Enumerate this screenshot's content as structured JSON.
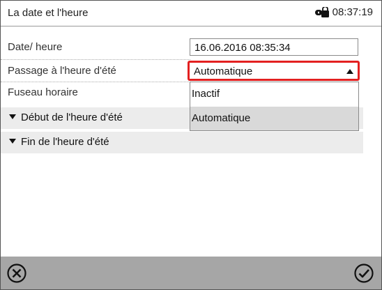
{
  "header": {
    "title": "La date et l'heure",
    "time": "08:37:19",
    "lock_icon": "lock-icon"
  },
  "rows": {
    "date_label": "Date/ heure",
    "date_value": "16.06.2016 08:35:34",
    "dst_label": "Passage à l'heure d'été",
    "dst_value": "Automatique",
    "timezone_label": "Fuseau horaire",
    "dst_start_label": "Début de l'heure d'été",
    "dst_end_label": "Fin de l'heure d'été"
  },
  "dropdown": {
    "options": [
      "Inactif",
      "Automatique"
    ],
    "selected": "Automatique"
  },
  "footer": {
    "cancel_icon": "close-circle-icon",
    "confirm_icon": "check-circle-icon"
  },
  "colors": {
    "highlight_border": "#e32020",
    "footer_bg": "#a6a6a6",
    "selected_option_bg": "#d9d9d9",
    "section_bg": "#ececec"
  }
}
